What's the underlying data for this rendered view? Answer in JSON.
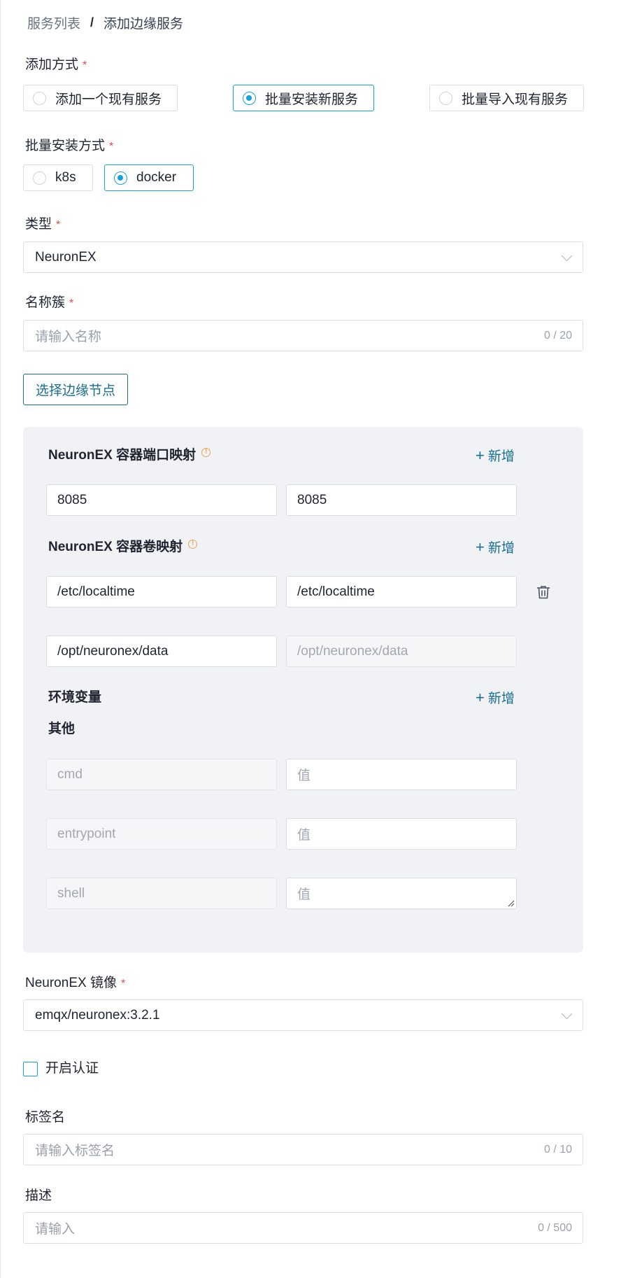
{
  "breadcrumb": {
    "parent": "服务列表",
    "separator": "/",
    "current": "添加边缘服务"
  },
  "add_method": {
    "label": "添加方式",
    "required": "*",
    "options": [
      {
        "label": "添加一个现有服务",
        "checked": false
      },
      {
        "label": "批量安装新服务",
        "checked": true
      },
      {
        "label": "批量导入现有服务",
        "checked": false
      }
    ]
  },
  "install_method": {
    "label": "批量安装方式",
    "required": "*",
    "options": [
      {
        "label": "k8s",
        "checked": false
      },
      {
        "label": "docker",
        "checked": true
      }
    ]
  },
  "type": {
    "label": "类型",
    "required": "*",
    "value": "NeuronEX"
  },
  "cluster_name": {
    "label": "名称簇",
    "required": "*",
    "placeholder": "请输入名称",
    "counter": "0 / 20"
  },
  "select_nodes_button": "选择边缘节点",
  "port_mapping": {
    "title": "NeuronEX 容器端口映射",
    "info_icon": "!",
    "add_label": "新增",
    "rows": [
      {
        "host": "8085",
        "container": "8085"
      }
    ]
  },
  "volume_mapping": {
    "title": "NeuronEX 容器卷映射",
    "info_icon": "!",
    "add_label": "新增",
    "rows": [
      {
        "host": "/etc/localtime",
        "container": "/etc/localtime"
      },
      {
        "host": "/opt/neuronex/data",
        "container_placeholder": "/opt/neuronex/data"
      }
    ]
  },
  "env": {
    "title": "环境变量",
    "add_label": "新增"
  },
  "other": {
    "title": "其他",
    "rows": [
      {
        "key_placeholder": "cmd",
        "value_placeholder": "值"
      },
      {
        "key_placeholder": "entrypoint",
        "value_placeholder": "值"
      },
      {
        "key_placeholder": "shell",
        "value_placeholder": "值"
      }
    ]
  },
  "image": {
    "label": "NeuronEX 镜像",
    "required": "*",
    "value": "emqx/neuronex:3.2.1"
  },
  "auth_checkbox": {
    "label": "开启认证",
    "checked": false
  },
  "tag_name": {
    "label": "标签名",
    "placeholder": "请输入标签名",
    "counter": "0 / 10"
  },
  "description": {
    "label": "描述",
    "placeholder": "请输入",
    "counter": "0 / 500"
  },
  "colors": {
    "accent": "#16a3d7",
    "link": "#1a6f8f",
    "required": "#e5484d",
    "warning": "#f0a352",
    "panel": "#f0f2f6"
  },
  "icons": {
    "delete": "trash-icon",
    "select": "chevron-down-icon",
    "add": "plus-icon"
  }
}
